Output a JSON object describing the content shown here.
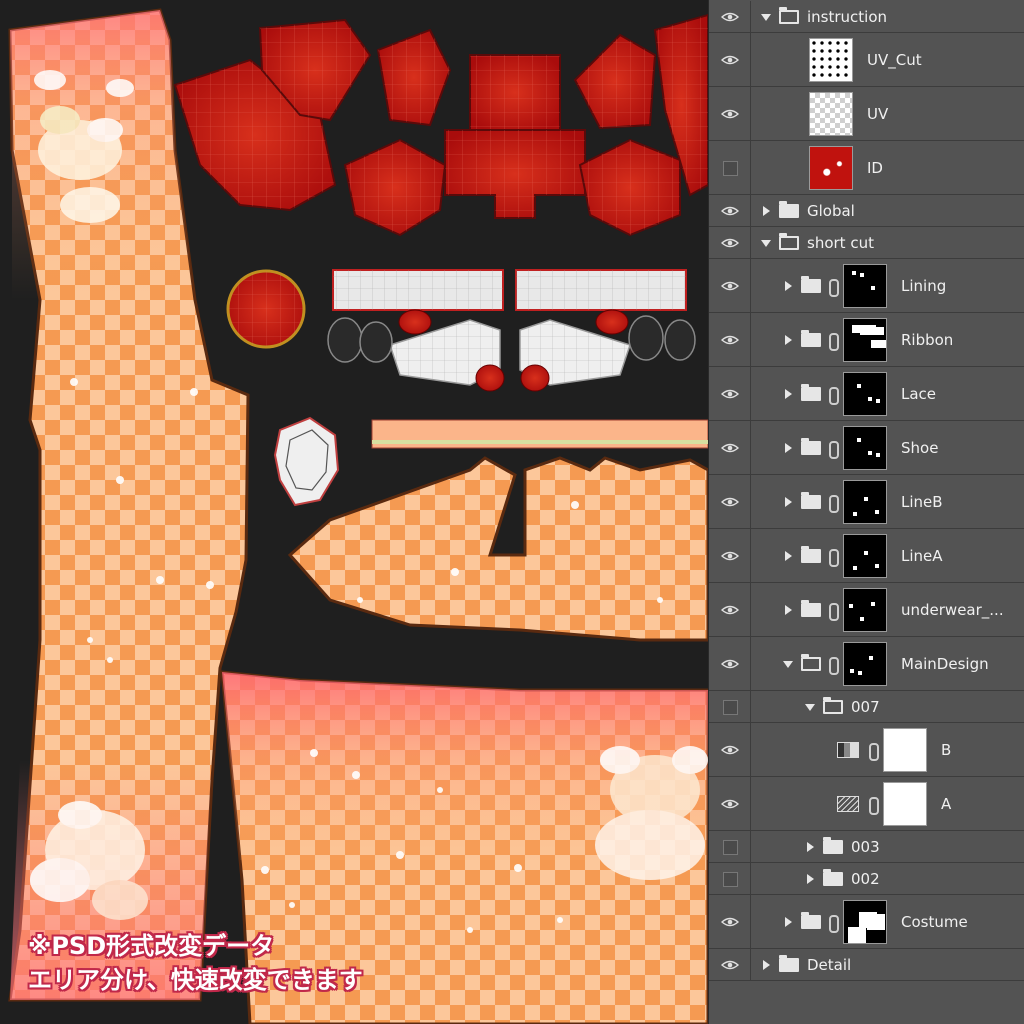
{
  "caption": {
    "line1": "※PSD形式改変データ",
    "line2": "エリア分け、快速改変できます"
  },
  "colors": {
    "panel_bg": "#535353",
    "canvas_bg": "#1f1f1f",
    "uv_red": "#c0120e",
    "check_orange": "#f4a060",
    "check_light": "#fcd0a0",
    "caption_stroke": "#c0284a"
  },
  "layers": [
    {
      "label": "instruction",
      "visible": true,
      "type": "group",
      "expanded": true,
      "depth": 0
    },
    {
      "label": "UV_Cut",
      "visible": true,
      "type": "layer",
      "thumb": "uvcut",
      "depth": 1
    },
    {
      "label": "UV",
      "visible": true,
      "type": "layer",
      "thumb": "transparent",
      "depth": 1
    },
    {
      "label": "ID",
      "visible": false,
      "type": "layer",
      "thumb": "red",
      "depth": 1
    },
    {
      "label": "Global",
      "visible": true,
      "type": "group",
      "expanded": false,
      "depth": 0
    },
    {
      "label": "short cut",
      "visible": true,
      "type": "group",
      "expanded": true,
      "depth": 0
    },
    {
      "label": "Lining",
      "visible": true,
      "type": "masked-group",
      "depth": 1
    },
    {
      "label": "Ribbon",
      "visible": true,
      "type": "masked-group",
      "depth": 1
    },
    {
      "label": "Lace",
      "visible": true,
      "type": "masked-group",
      "depth": 1
    },
    {
      "label": "Shoe",
      "visible": true,
      "type": "masked-group",
      "depth": 1
    },
    {
      "label": "LineB",
      "visible": true,
      "type": "masked-group",
      "depth": 1
    },
    {
      "label": "LineA",
      "visible": true,
      "type": "masked-group",
      "depth": 1
    },
    {
      "label": "underwear_...",
      "visible": true,
      "type": "masked-group",
      "depth": 1
    },
    {
      "label": "MainDesign",
      "visible": true,
      "type": "masked-group",
      "expanded": true,
      "depth": 1
    },
    {
      "label": "007",
      "visible": false,
      "type": "group",
      "expanded": true,
      "depth": 2
    },
    {
      "label": "B",
      "visible": true,
      "type": "adjustment",
      "icon": "levels-icon",
      "depth": 3
    },
    {
      "label": "A",
      "visible": true,
      "type": "adjustment",
      "icon": "curves-icon",
      "depth": 3
    },
    {
      "label": "003",
      "visible": false,
      "type": "group",
      "expanded": false,
      "depth": 2
    },
    {
      "label": "002",
      "visible": false,
      "type": "group",
      "expanded": false,
      "depth": 2
    },
    {
      "label": "Costume",
      "visible": true,
      "type": "masked-group",
      "depth": 1
    },
    {
      "label": "Detail",
      "visible": true,
      "type": "group",
      "expanded": false,
      "depth": 0
    }
  ]
}
